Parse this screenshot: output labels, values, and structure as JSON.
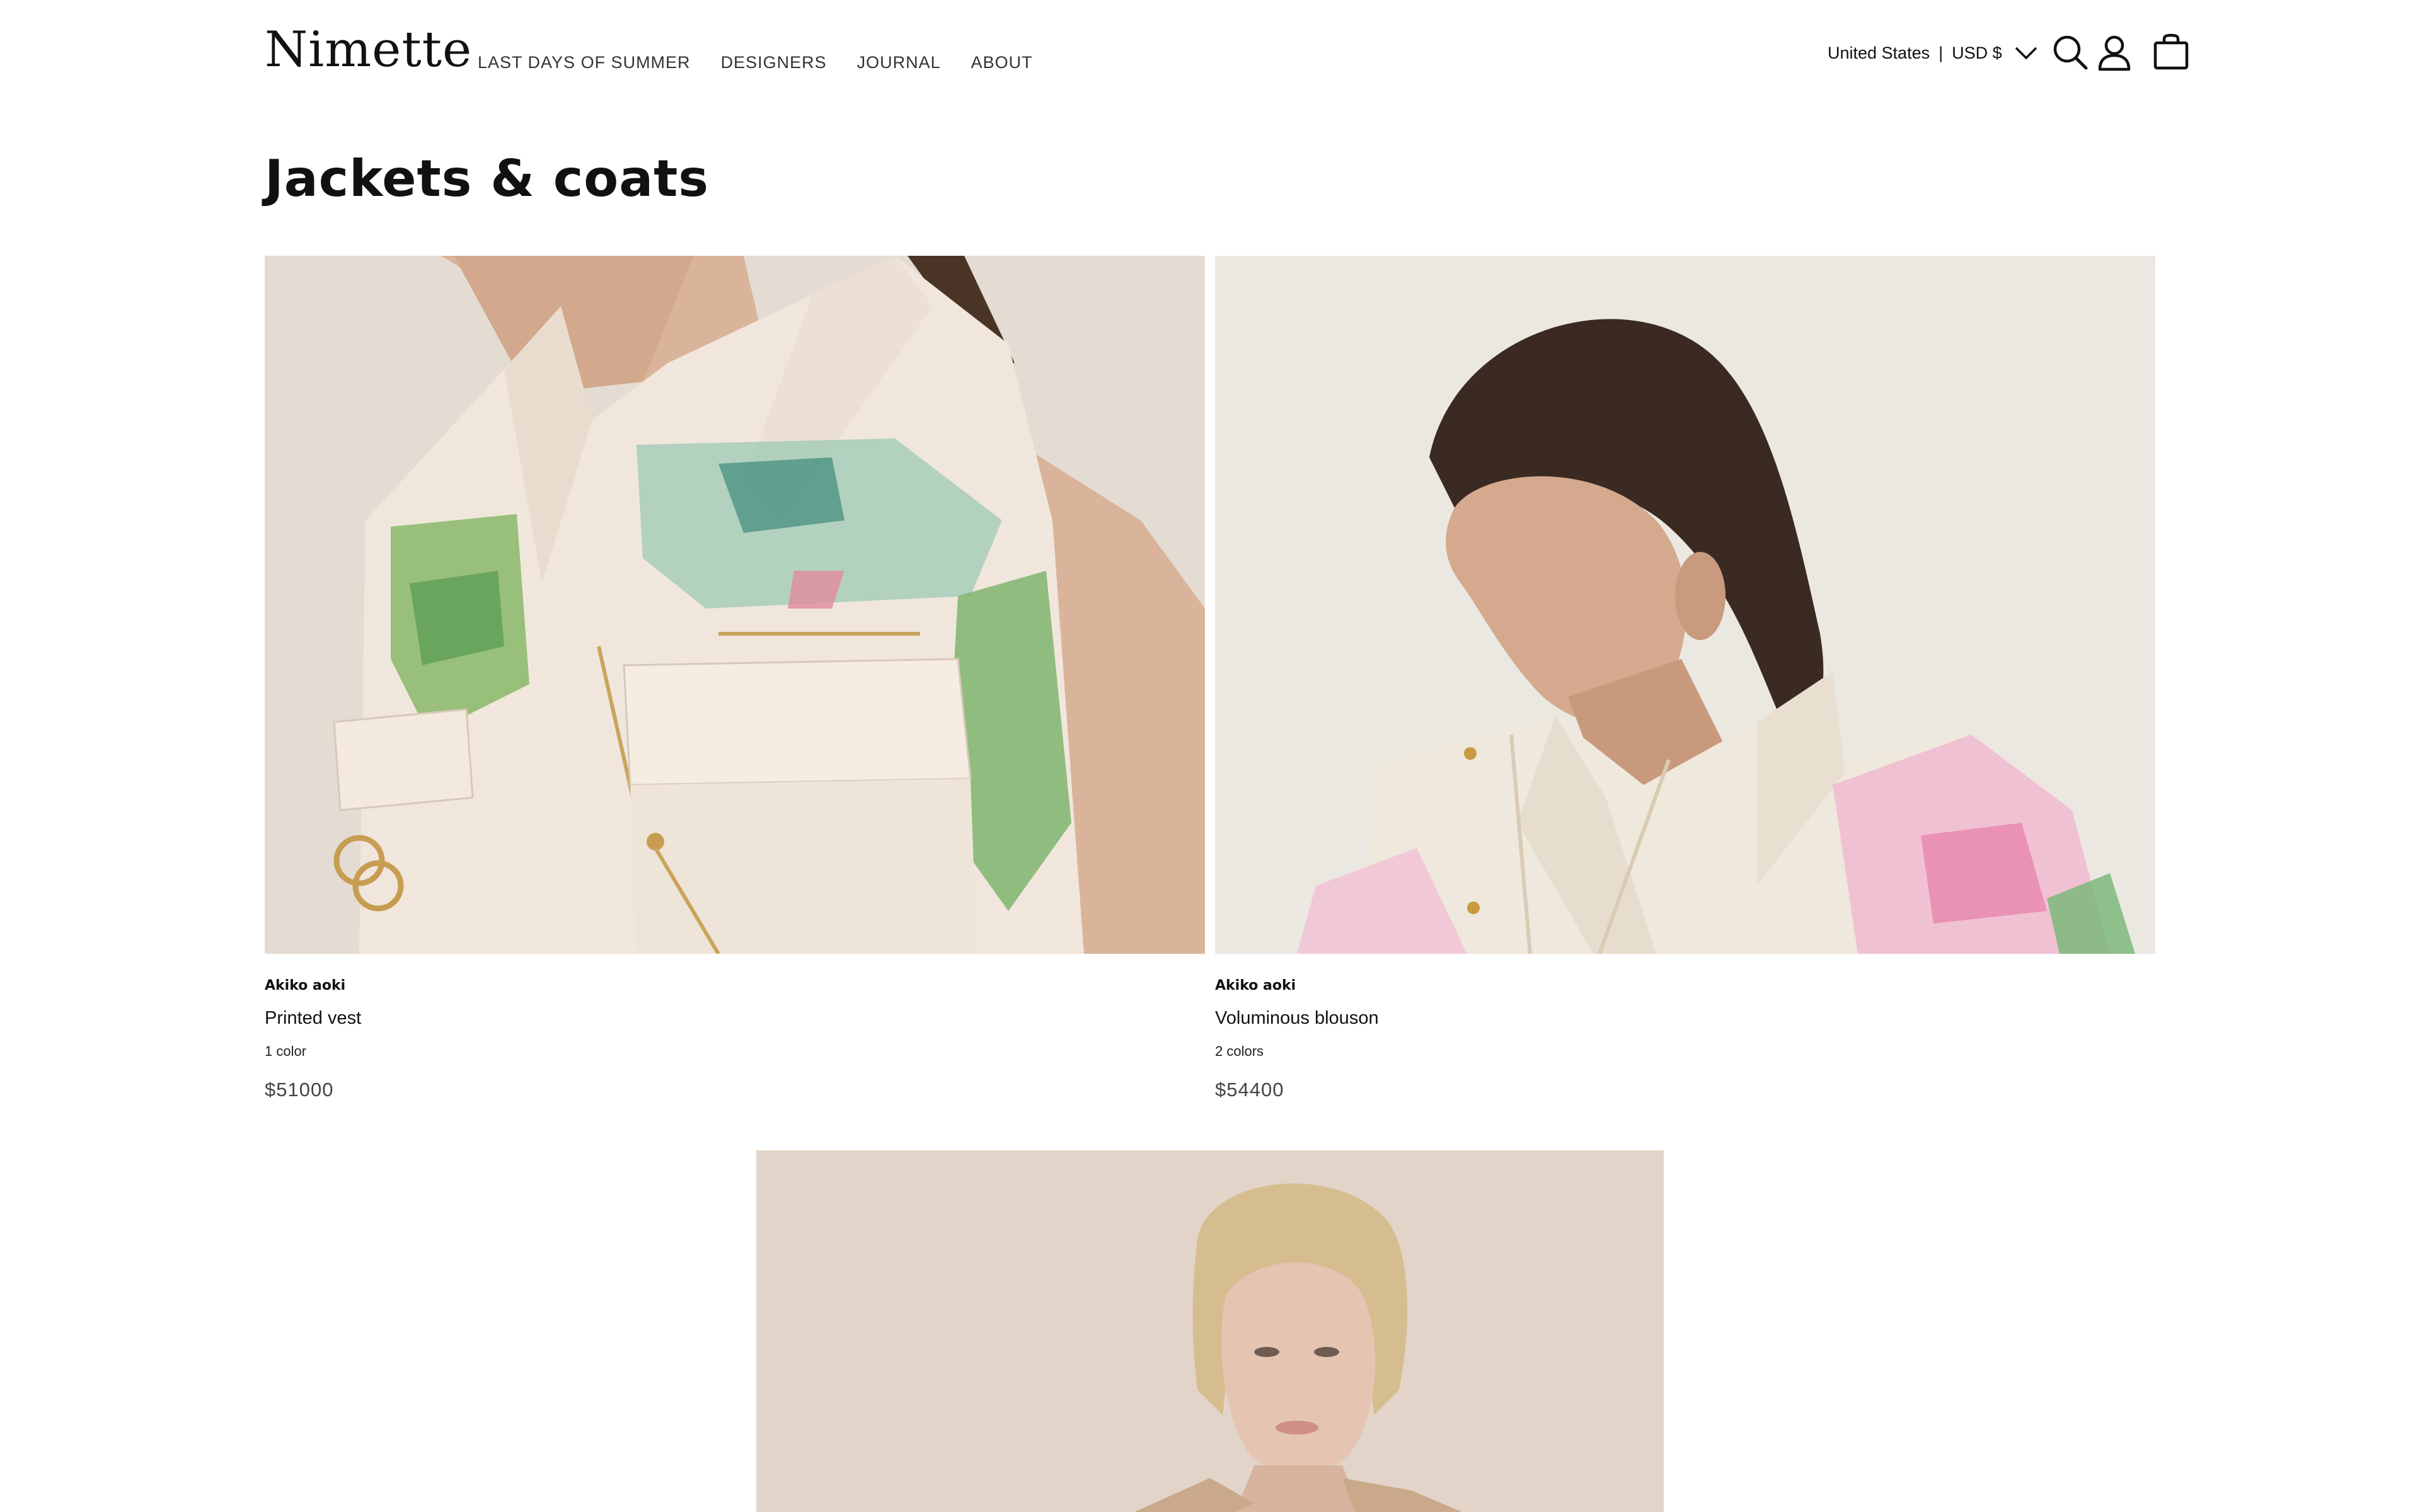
{
  "header": {
    "logo": "Nimette",
    "nav": [
      "LAST DAYS OF SUMMER",
      "DESIGNERS",
      "JOURNAL",
      "ABOUT"
    ],
    "locale": {
      "country": "United States",
      "separator": "|",
      "currency": "USD $"
    },
    "icons": [
      "chevron-down-icon",
      "search-icon",
      "account-icon",
      "shopping-bag-icon"
    ]
  },
  "page": {
    "title": "Jackets & coats"
  },
  "products": [
    {
      "brand": "Akiko aoki",
      "name": "Printed vest",
      "colors": "1 color",
      "price": "$51000"
    },
    {
      "brand": "Akiko aoki",
      "name": "Voluminous blouson",
      "colors": "2 colors",
      "price": "$54400"
    },
    {
      "brand": "",
      "name": "",
      "colors": "",
      "price": ""
    }
  ],
  "colors": {
    "background": "#ffffff",
    "text": "#111111",
    "price_text": "#444444"
  }
}
